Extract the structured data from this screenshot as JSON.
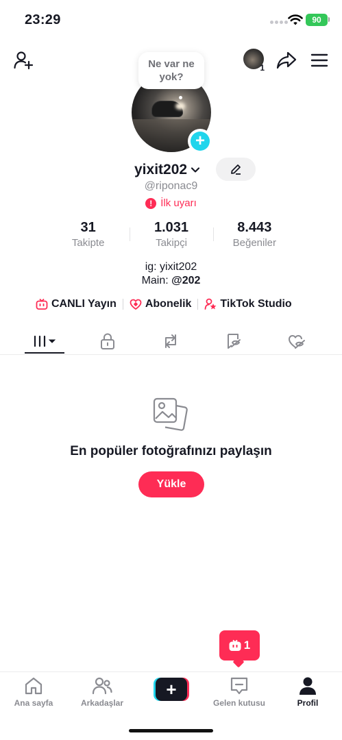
{
  "status": {
    "time": "23:29",
    "battery": "90"
  },
  "header": {
    "mini_avatar_count": "1"
  },
  "profile": {
    "bubble": "Ne var ne yok?",
    "username": "yixit202",
    "handle": "@riponac9",
    "warning": "İlk uyarı"
  },
  "stats": [
    {
      "value": "31",
      "label": "Takipte"
    },
    {
      "value": "1.031",
      "label": "Takipçi"
    },
    {
      "value": "8.443",
      "label": "Beğeniler"
    }
  ],
  "bio": {
    "line1": "ig: yixit202",
    "line2_prefix": "Main: ",
    "line2_bold": "@202"
  },
  "links": [
    {
      "label": "CANLI Yayın",
      "icon": "tv-icon"
    },
    {
      "label": "Abonelik",
      "icon": "subscription-icon"
    },
    {
      "label": "TikTok Studio",
      "icon": "studio-icon"
    }
  ],
  "tabs": [
    {
      "icon": "grid-icon",
      "active": true
    },
    {
      "icon": "lock-icon",
      "active": false
    },
    {
      "icon": "repost-icon",
      "active": false
    },
    {
      "icon": "bookmark-hidden-icon",
      "active": false
    },
    {
      "icon": "liked-hidden-icon",
      "active": false
    }
  ],
  "empty": {
    "title": "En popüler fotoğrafınızı paylaşın",
    "button": "Yükle"
  },
  "live_badge": {
    "count": "1"
  },
  "bottom_nav": {
    "home": "Ana sayfa",
    "friends": "Arkadaşlar",
    "inbox": "Gelen kutusu",
    "profile": "Profil"
  },
  "colors": {
    "accent": "#fe2c55",
    "cyan": "#20d5ec",
    "text": "#161823",
    "muted": "#8a8b91"
  }
}
